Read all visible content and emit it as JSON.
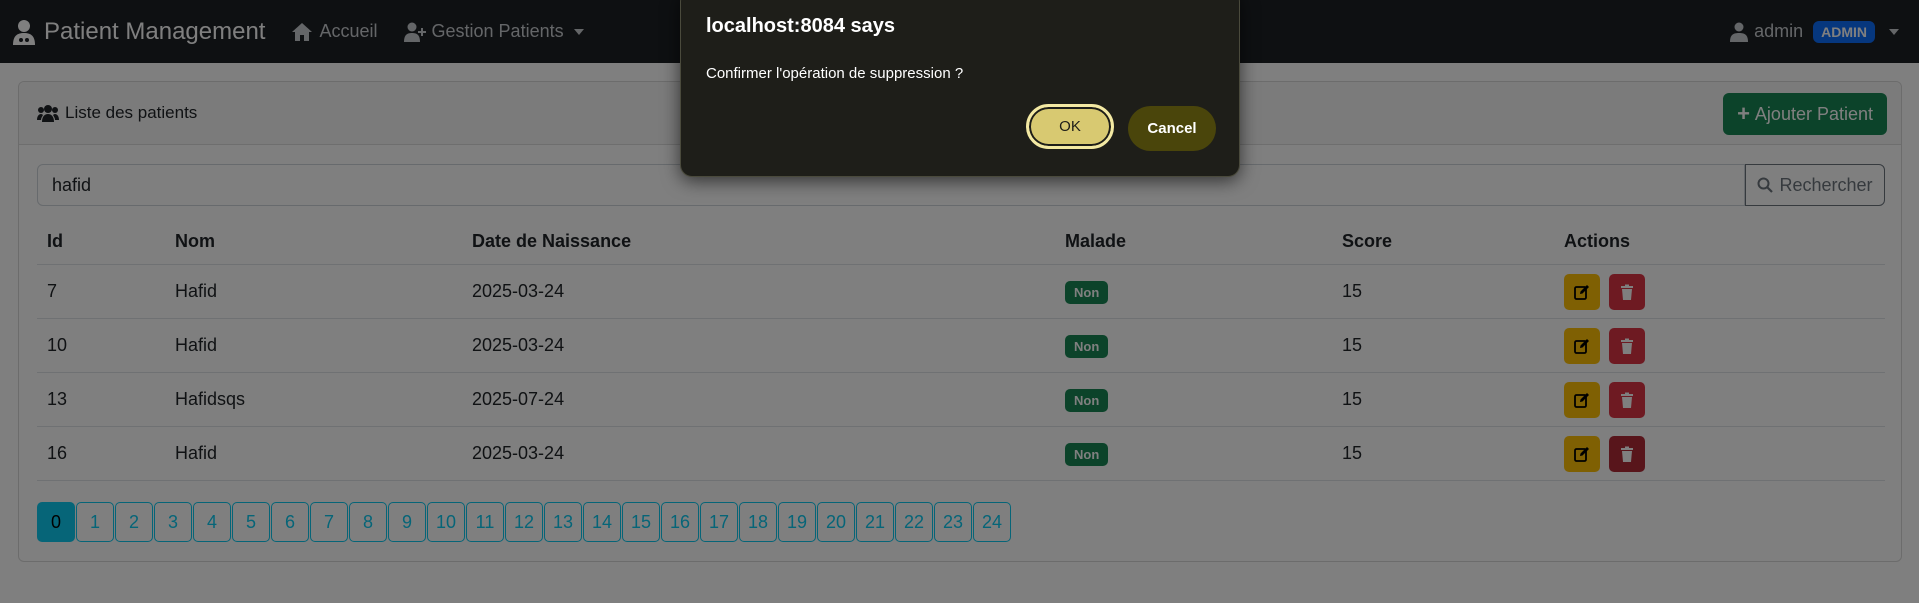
{
  "navbar": {
    "brand": "Patient Management",
    "home_label": "Accueil",
    "patients_menu_label": "Gestion Patients",
    "user_name": "admin",
    "user_role": "ADMIN"
  },
  "card": {
    "title": "Liste des patients",
    "add_button_label": "Ajouter Patient"
  },
  "search": {
    "value": "hafid",
    "button_label": "Rechercher"
  },
  "table": {
    "headers": [
      "Id",
      "Nom",
      "Date de Naissance",
      "Malade",
      "Score",
      "Actions"
    ],
    "rows": [
      {
        "id": "7",
        "nom": "Hafid",
        "date": "2025-03-24",
        "malade": "Non",
        "score": "15"
      },
      {
        "id": "10",
        "nom": "Hafid",
        "date": "2025-03-24",
        "malade": "Non",
        "score": "15"
      },
      {
        "id": "13",
        "nom": "Hafidsqs",
        "date": "2025-07-24",
        "malade": "Non",
        "score": "15"
      },
      {
        "id": "16",
        "nom": "Hafid",
        "date": "2025-03-24",
        "malade": "Non",
        "score": "15"
      }
    ]
  },
  "pagination": {
    "pages": [
      "0",
      "1",
      "2",
      "3",
      "4",
      "5",
      "6",
      "7",
      "8",
      "9",
      "10",
      "11",
      "12",
      "13",
      "14",
      "15",
      "16",
      "17",
      "18",
      "19",
      "20",
      "21",
      "22",
      "23",
      "24"
    ],
    "active": "0"
  },
  "dialog": {
    "title": "localhost:8084 says",
    "message": "Confirmer l'opération de suppression ?",
    "ok_label": "OK",
    "cancel_label": "Cancel"
  },
  "colors": {
    "navbar_bg": "#1d2025",
    "success": "#198754",
    "warning": "#ffc107",
    "danger": "#dc3545",
    "info": "#0dcaf0",
    "primary": "#0d6efd",
    "dialog_bg": "#1e1e19",
    "dialog_ok": "#d8c971",
    "dialog_cancel": "#4a450b"
  },
  "icons": {
    "brand": "user-doctor-icon",
    "home": "home-icon",
    "patients_menu": "user-plus-icon",
    "user": "user-icon",
    "card_title": "users-icon",
    "add": "plus-icon",
    "search": "search-icon",
    "edit": "edit-icon",
    "delete": "trash-icon"
  }
}
